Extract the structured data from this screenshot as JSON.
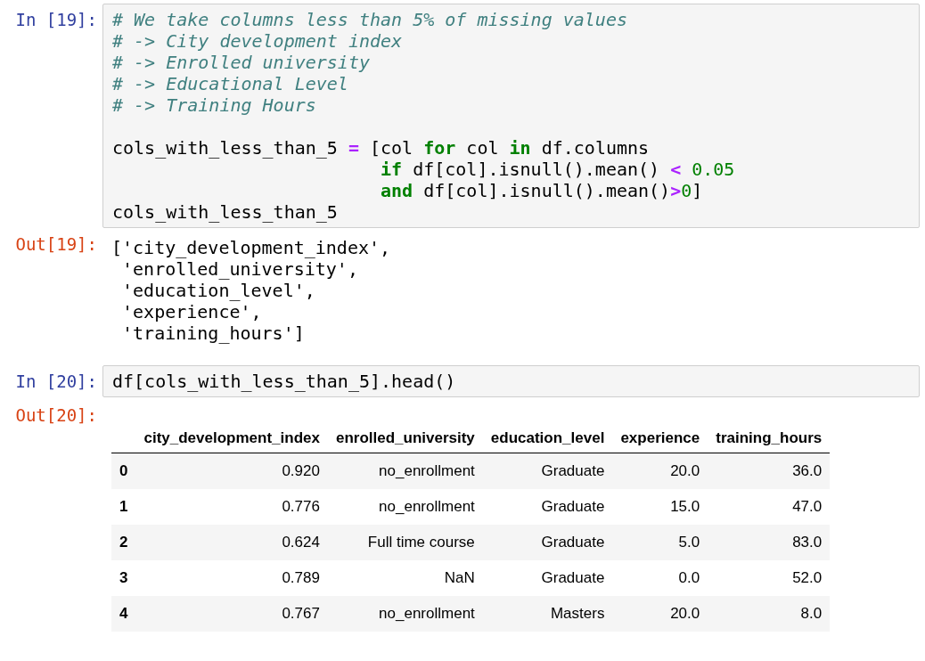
{
  "cells": [
    {
      "kind": "code",
      "prompt": "In [19]:",
      "blocks": [
        [
          {
            "tokens": [
              {
                "kind": "comment",
                "text": "# We take columns less than 5% of missing values"
              }
            ]
          },
          {
            "tokens": [
              {
                "kind": "comment",
                "text": "# -> City development index"
              }
            ]
          },
          {
            "tokens": [
              {
                "kind": "comment",
                "text": "# -> Enrolled university"
              }
            ]
          },
          {
            "tokens": [
              {
                "kind": "comment",
                "text": "# -> Educational Level"
              }
            ]
          },
          {
            "tokens": [
              {
                "kind": "comment",
                "text": "# -> Training Hours"
              }
            ]
          }
        ],
        [
          {
            "tokens": [
              {
                "kind": "plain",
                "text": "cols_with_less_than_5 "
              },
              {
                "kind": "operator",
                "text": "="
              },
              {
                "kind": "plain",
                "text": " [col "
              },
              {
                "kind": "keyword",
                "text": "for"
              },
              {
                "kind": "plain",
                "text": " col "
              },
              {
                "kind": "keyword",
                "text": "in"
              },
              {
                "kind": "plain",
                "text": " df.columns"
              }
            ]
          },
          {
            "tokens": [
              {
                "kind": "keyword",
                "text": "                         if"
              },
              {
                "kind": "plain",
                "text": " df[col].isnull().mean() "
              },
              {
                "kind": "operator",
                "text": "<"
              },
              {
                "kind": "number",
                "text": " 0.05"
              }
            ]
          },
          {
            "tokens": [
              {
                "kind": "keyword",
                "text": "                         and"
              },
              {
                "kind": "plain",
                "text": " df[col].isnull().mean()"
              },
              {
                "kind": "operator",
                "text": ">"
              },
              {
                "kind": "number",
                "text": "0"
              },
              {
                "kind": "plain",
                "text": "]"
              }
            ]
          },
          {
            "tokens": [
              {
                "kind": "plain",
                "text": "cols_with_less_than_5"
              }
            ]
          }
        ]
      ]
    },
    {
      "kind": "text_output",
      "prompt": "Out[19]:",
      "lines": [
        "['city_development_index',",
        " 'enrolled_university',",
        " 'education_level',",
        " 'experience',",
        " 'training_hours']"
      ]
    },
    {
      "kind": "code",
      "prompt": "In [20]:",
      "blocks": [
        [
          {
            "tokens": [
              {
                "kind": "plain",
                "text": "df[cols_with_less_than_5].head()"
              }
            ]
          }
        ]
      ]
    },
    {
      "kind": "table_output",
      "prompt": "Out[20]:",
      "columns": [
        "city_development_index",
        "enrolled_university",
        "education_level",
        "experience",
        "training_hours"
      ],
      "rows": [
        {
          "index": "0",
          "cells": [
            "0.920",
            "no_enrollment",
            "Graduate",
            "20.0",
            "36.0"
          ]
        },
        {
          "index": "1",
          "cells": [
            "0.776",
            "no_enrollment",
            "Graduate",
            "15.0",
            "47.0"
          ]
        },
        {
          "index": "2",
          "cells": [
            "0.624",
            "Full time course",
            "Graduate",
            "5.0",
            "83.0"
          ]
        },
        {
          "index": "3",
          "cells": [
            "0.789",
            "NaN",
            "Graduate",
            "0.0",
            "52.0"
          ]
        },
        {
          "index": "4",
          "cells": [
            "0.767",
            "no_enrollment",
            "Masters",
            "20.0",
            "8.0"
          ]
        }
      ]
    }
  ]
}
